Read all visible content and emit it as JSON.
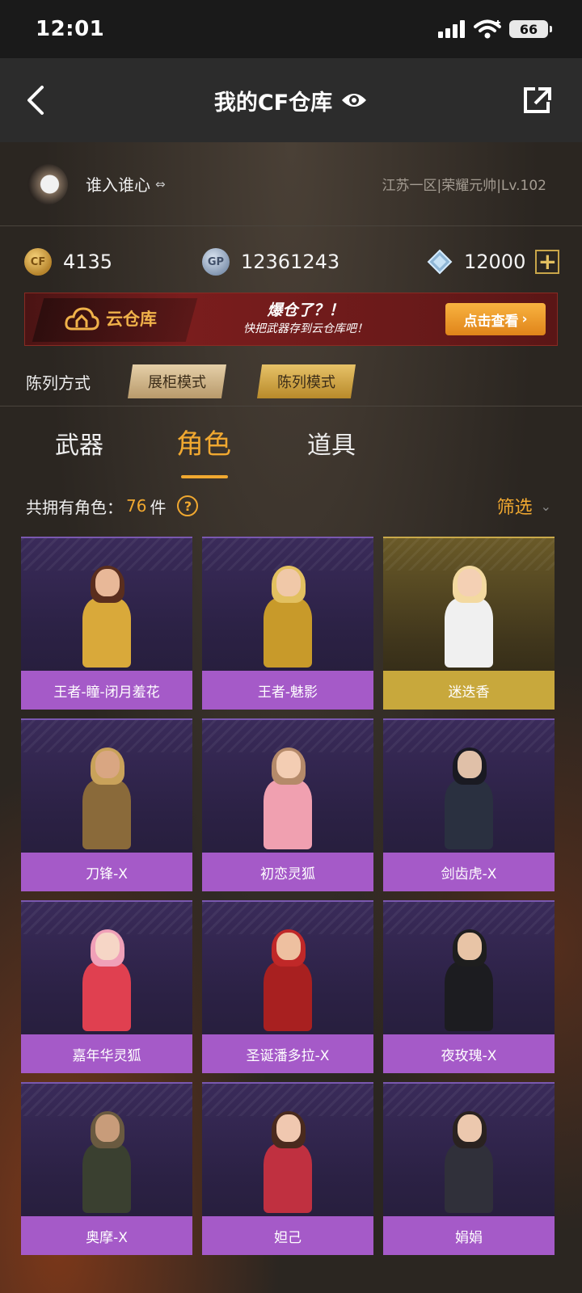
{
  "status_bar": {
    "time": "12:01",
    "battery": "66"
  },
  "nav": {
    "title": "我的CF仓库"
  },
  "profile": {
    "nickname": "谁入谁心",
    "swap_symbol": "⇔",
    "server_info": "江苏一区|荣耀元帅|Lv.102"
  },
  "currency": {
    "cf_icon_text": "CF",
    "cf": "4135",
    "gp_icon_text": "GP",
    "gp": "12361243",
    "diamond": "12000"
  },
  "banner": {
    "logo_text": "云仓库",
    "slogan_line1": "爆仓了？！",
    "slogan_line2": "快把武器存到云仓库吧！",
    "button_label": "点击查看",
    "button_arrow": "›"
  },
  "display": {
    "label": "陈列方式",
    "cabinet_mode": "展柜模式",
    "list_mode": "陈列模式"
  },
  "tabs": [
    {
      "label": "武器"
    },
    {
      "label": "角色",
      "active": true
    },
    {
      "label": "道具"
    }
  ],
  "count": {
    "prefix": "共拥有角色：",
    "number": "76",
    "suffix": "件",
    "help": "?"
  },
  "filter": {
    "label": "筛选",
    "chevron": "⌄"
  },
  "roles": [
    {
      "name": "王者-瞳-闭月羞花",
      "rarity": "purple",
      "hair": "#5a2e1e",
      "skin": "#e8b898",
      "outfit": "#d9a93a"
    },
    {
      "name": "王者-魅影",
      "rarity": "purple",
      "hair": "#e2c060",
      "skin": "#f0c8a8",
      "outfit": "#c89a2a"
    },
    {
      "name": "迷迭香",
      "rarity": "gold",
      "hair": "#f3d9a0",
      "skin": "#f4d0b4",
      "outfit": "#f0f0f0"
    },
    {
      "name": "刀锋-X",
      "rarity": "purple",
      "hair": "#c9a25a",
      "skin": "#d9a682",
      "outfit": "#8a6a3a"
    },
    {
      "name": "初恋灵狐",
      "rarity": "purple",
      "hair": "#b58a6a",
      "skin": "#f3cdb3",
      "outfit": "#f0a0b0"
    },
    {
      "name": "剑齿虎-X",
      "rarity": "purple",
      "hair": "#1a1a22",
      "skin": "#e0c0a8",
      "outfit": "#2a3040"
    },
    {
      "name": "嘉年华灵狐",
      "rarity": "purple",
      "hair": "#f0a0b8",
      "skin": "#f6d6c6",
      "outfit": "#e04050"
    },
    {
      "name": "圣诞潘多拉-X",
      "rarity": "purple",
      "hair": "#c02828",
      "skin": "#eec0a0",
      "outfit": "#a82020"
    },
    {
      "name": "夜玫瑰-X",
      "rarity": "purple",
      "hair": "#1e1e1e",
      "skin": "#e8c4a6",
      "outfit": "#1c1c20"
    },
    {
      "name": "奥摩-X",
      "rarity": "purple",
      "hair": "#6a5a40",
      "skin": "#c89c7a",
      "outfit": "#3a4030"
    },
    {
      "name": "妲己",
      "rarity": "purple",
      "hair": "#4a2a1e",
      "skin": "#f0c8b0",
      "outfit": "#c03040"
    },
    {
      "name": "娟娟",
      "rarity": "purple",
      "hair": "#2a2220",
      "skin": "#ecc8ae",
      "outfit": "#30303a"
    }
  ],
  "colors": {
    "accent": "#f0a830",
    "card_name_purple": "#a55ac8",
    "card_name_gold": "#c8a83c"
  },
  "icons": [
    "back-arrow-icon",
    "eye-icon",
    "share-icon",
    "cf-coin-icon",
    "gp-coin-icon",
    "diamond-icon",
    "plus-icon",
    "cloud-house-icon",
    "help-icon",
    "chevron-down-icon"
  ]
}
